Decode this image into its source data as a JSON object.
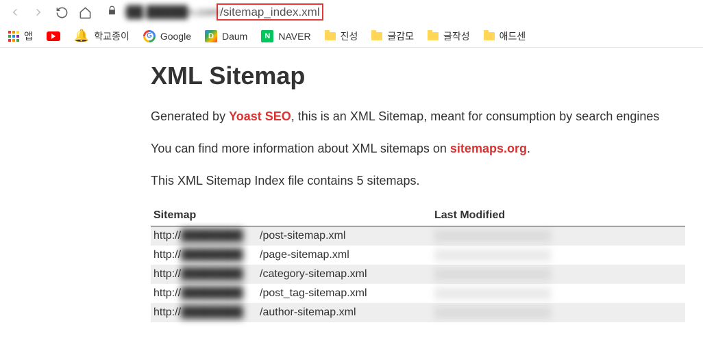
{
  "toolbar": {
    "url_domain_obscured": "i██.█████n.com",
    "url_path": "/sitemap_index.xml"
  },
  "bookmarks": {
    "apps_label": "앱",
    "items": [
      {
        "icon": "youtube",
        "label": ""
      },
      {
        "icon": "bell",
        "label": "학교종이"
      },
      {
        "icon": "google",
        "label": "Google"
      },
      {
        "icon": "daum",
        "label": "Daum"
      },
      {
        "icon": "naver",
        "label": "NAVER"
      },
      {
        "icon": "folder",
        "label": "진성"
      },
      {
        "icon": "folder",
        "label": "글감모"
      },
      {
        "icon": "folder",
        "label": "글작성"
      },
      {
        "icon": "folder",
        "label": "애드센"
      }
    ]
  },
  "page": {
    "title": "XML Sitemap",
    "generated_prefix": "Generated by ",
    "generated_link": "Yoast SEO",
    "generated_suffix": ", this is an XML Sitemap, meant for consumption by search engines",
    "info_prefix": "You can find more information about XML sitemaps on ",
    "info_link": "sitemaps.org",
    "info_suffix": ".",
    "count_text": "This XML Sitemap Index file contains 5 sitemaps.",
    "table": {
      "header_sitemap": "Sitemap",
      "header_modified": "Last Modified",
      "rows": [
        {
          "prefix": "http://",
          "domain_obscured": "████████",
          "suffix": "/post-sitemap.xml"
        },
        {
          "prefix": "http://",
          "domain_obscured": "████████",
          "suffix": "/page-sitemap.xml"
        },
        {
          "prefix": "http://",
          "domain_obscured": "████████",
          "suffix": "/category-sitemap.xml"
        },
        {
          "prefix": "http://",
          "domain_obscured": "████████",
          "suffix": "/post_tag-sitemap.xml"
        },
        {
          "prefix": "http://",
          "domain_obscured": "████████",
          "suffix": "/author-sitemap.xml"
        }
      ]
    }
  }
}
